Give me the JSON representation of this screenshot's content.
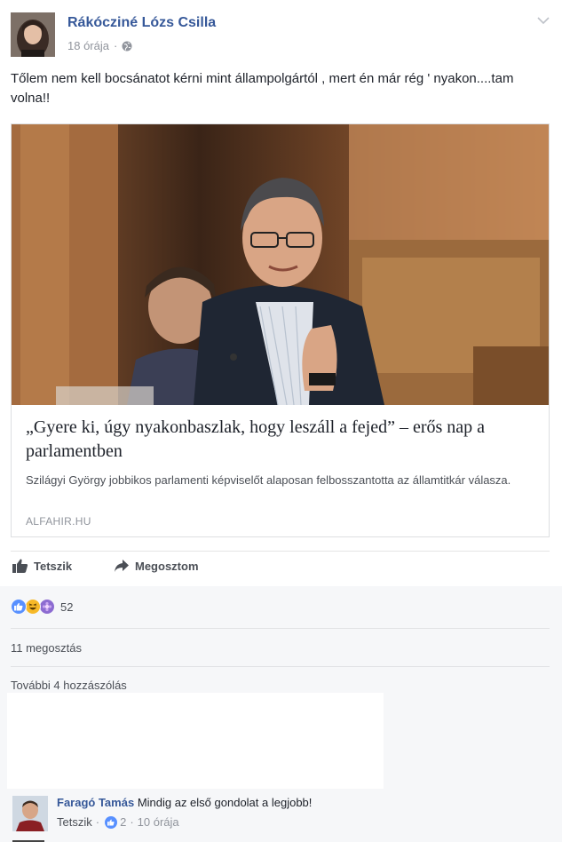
{
  "post": {
    "author": "Rákócziné Lózs Csilla",
    "time": "18 órája",
    "meta_separator": "·",
    "privacy_icon": "globe-icon",
    "text": "Tőlem nem kell bocsánatot kérni mint állampolgártól , mert én már rég ' nyakon....tam volna!!"
  },
  "link_card": {
    "title": "„Gyere ki, úgy nyakonbaszlak, hogy leszáll a fejed” – erős nap a parlamentben",
    "description": "Szilágyi György jobbikos parlamenti képviselőt alaposan felbosszantotta az államtitkár válasza.",
    "source": "ALFAHIR.HU"
  },
  "actions": {
    "like_label": "Tetszik",
    "share_label": "Megosztom"
  },
  "feedback": {
    "reaction_icons": [
      "like-icon",
      "haha-icon",
      "love-icon"
    ],
    "reaction_count": "52",
    "shares": "11 megosztás",
    "more_comments": "További 4 hozzászólás"
  },
  "comment": {
    "author": "Faragó Tamás",
    "text": "Mindig az első gondolat a legjobb!",
    "like_label": "Tetszik",
    "separator": "·",
    "like_count": "2",
    "time": "10 órája"
  },
  "colors": {
    "link_blue": "#365899",
    "meta_grey": "#90949c",
    "like_blue": "#5890ff",
    "haha_yellow": "#f7b928",
    "love_purple": "#8c6bd1"
  }
}
